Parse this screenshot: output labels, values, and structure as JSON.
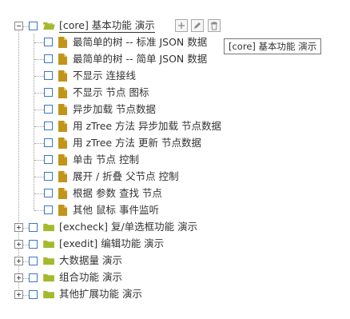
{
  "tree": {
    "root": {
      "label": "[core] 基本功能 演示",
      "children": [
        "最简单的树 -- 标准 JSON 数据",
        "最简单的树 -- 简单 JSON 数据",
        "不显示 连接线",
        "不显示 节点 图标",
        "异步加载 节点数据",
        "用 zTree 方法 异步加载 节点数据",
        "用 zTree 方法 更新 节点数据",
        "单击 节点 控制",
        "展开 / 折叠 父节点 控制",
        "根据 参数 查找 节点",
        "其他 鼠标 事件监听"
      ]
    },
    "others": [
      "[excheck] 复/单选框功能 演示",
      "[exedit] 编辑功能 演示",
      "大数据量 演示",
      "组合功能 演示",
      "其他扩展功能 演示"
    ]
  },
  "tooltip": "[core] 基本功能 演示",
  "colors": {
    "folder": "#a5b92c",
    "doc": "#c1941b",
    "checkbox": "#3b78c2"
  }
}
